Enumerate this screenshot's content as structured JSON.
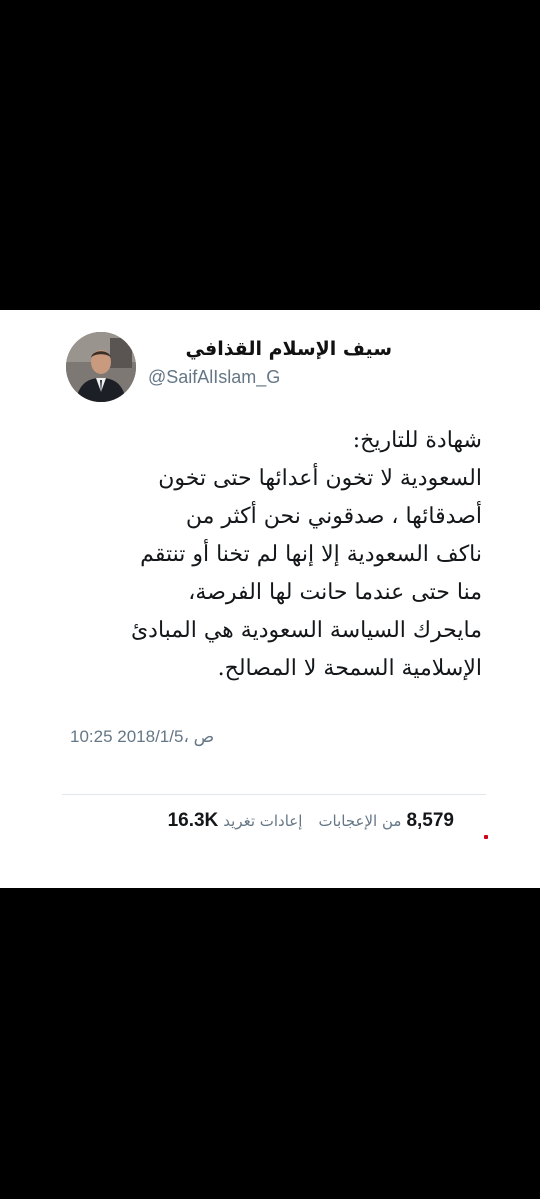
{
  "tweet": {
    "display_name": "سيف الإسلام القذافي",
    "handle": "@SaifAlIslam_G",
    "avatar_icon": "profile-photo",
    "body_lines": [
      "شهادة للتاريخ:",
      "السعودية لا تخون أعدائها حتى تخون",
      "أصدقائها ، صدقوني نحن أكثر من",
      "ناكف السعودية إلا إنها لم تخنا أو تنتقم",
      "منا حتى عندما حانت لها الفرصة،",
      "مايحرك السياسة السعودية هي المبادئ",
      "الإسلامية السمحة لا المصالح."
    ],
    "timestamp": "10:25 ص ،2018/1/5",
    "stats": {
      "likes_count": "8,579",
      "likes_label": "من الإعجابات",
      "retweets_label": "إعادات تغريد",
      "retweets_count": "16.3K"
    }
  },
  "colors": {
    "background": "#000000",
    "card": "#ffffff",
    "text": "#14171a",
    "secondary_text": "#657786",
    "divider": "#e1e8ed"
  }
}
